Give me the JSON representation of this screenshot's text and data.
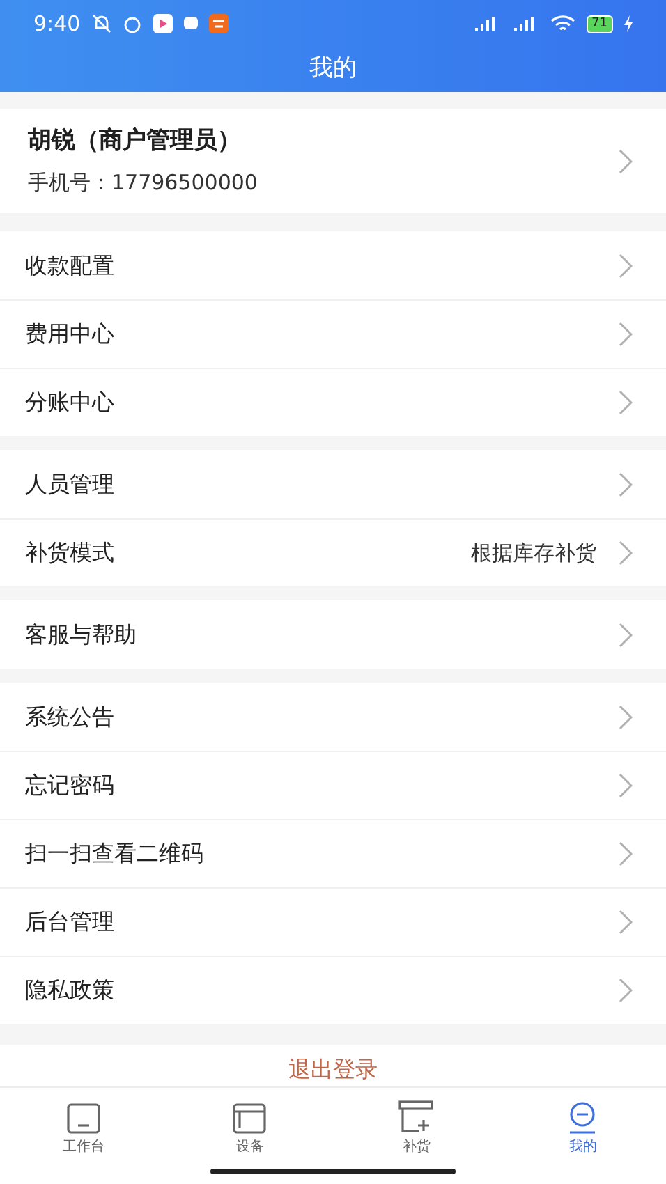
{
  "status_bar": {
    "time": "9:40",
    "battery": "71"
  },
  "header": {
    "title": "我的"
  },
  "profile": {
    "name": "胡锐（商户管理员）",
    "phone": "手机号：17796500000"
  },
  "menu_groups": [
    {
      "items": [
        {
          "label": "收款配置"
        },
        {
          "label": "费用中心"
        },
        {
          "label": "分账中心"
        }
      ]
    },
    {
      "items": [
        {
          "label": "人员管理"
        },
        {
          "label": "补货模式",
          "value": "根据库存补货"
        }
      ]
    },
    {
      "items": [
        {
          "label": "客服与帮助"
        }
      ]
    },
    {
      "items": [
        {
          "label": "系统公告"
        },
        {
          "label": "忘记密码"
        },
        {
          "label": "扫一扫查看二维码"
        },
        {
          "label": "后台管理"
        },
        {
          "label": "隐私政策"
        }
      ]
    }
  ],
  "logout": "退出登录",
  "tab_bar": [
    {
      "label": "工作台",
      "kind": "desk",
      "selected": false
    },
    {
      "label": "设备",
      "kind": "device",
      "selected": false
    },
    {
      "label": "补货",
      "kind": "restock",
      "selected": false
    },
    {
      "label": "我的",
      "kind": "me",
      "selected": true
    }
  ]
}
